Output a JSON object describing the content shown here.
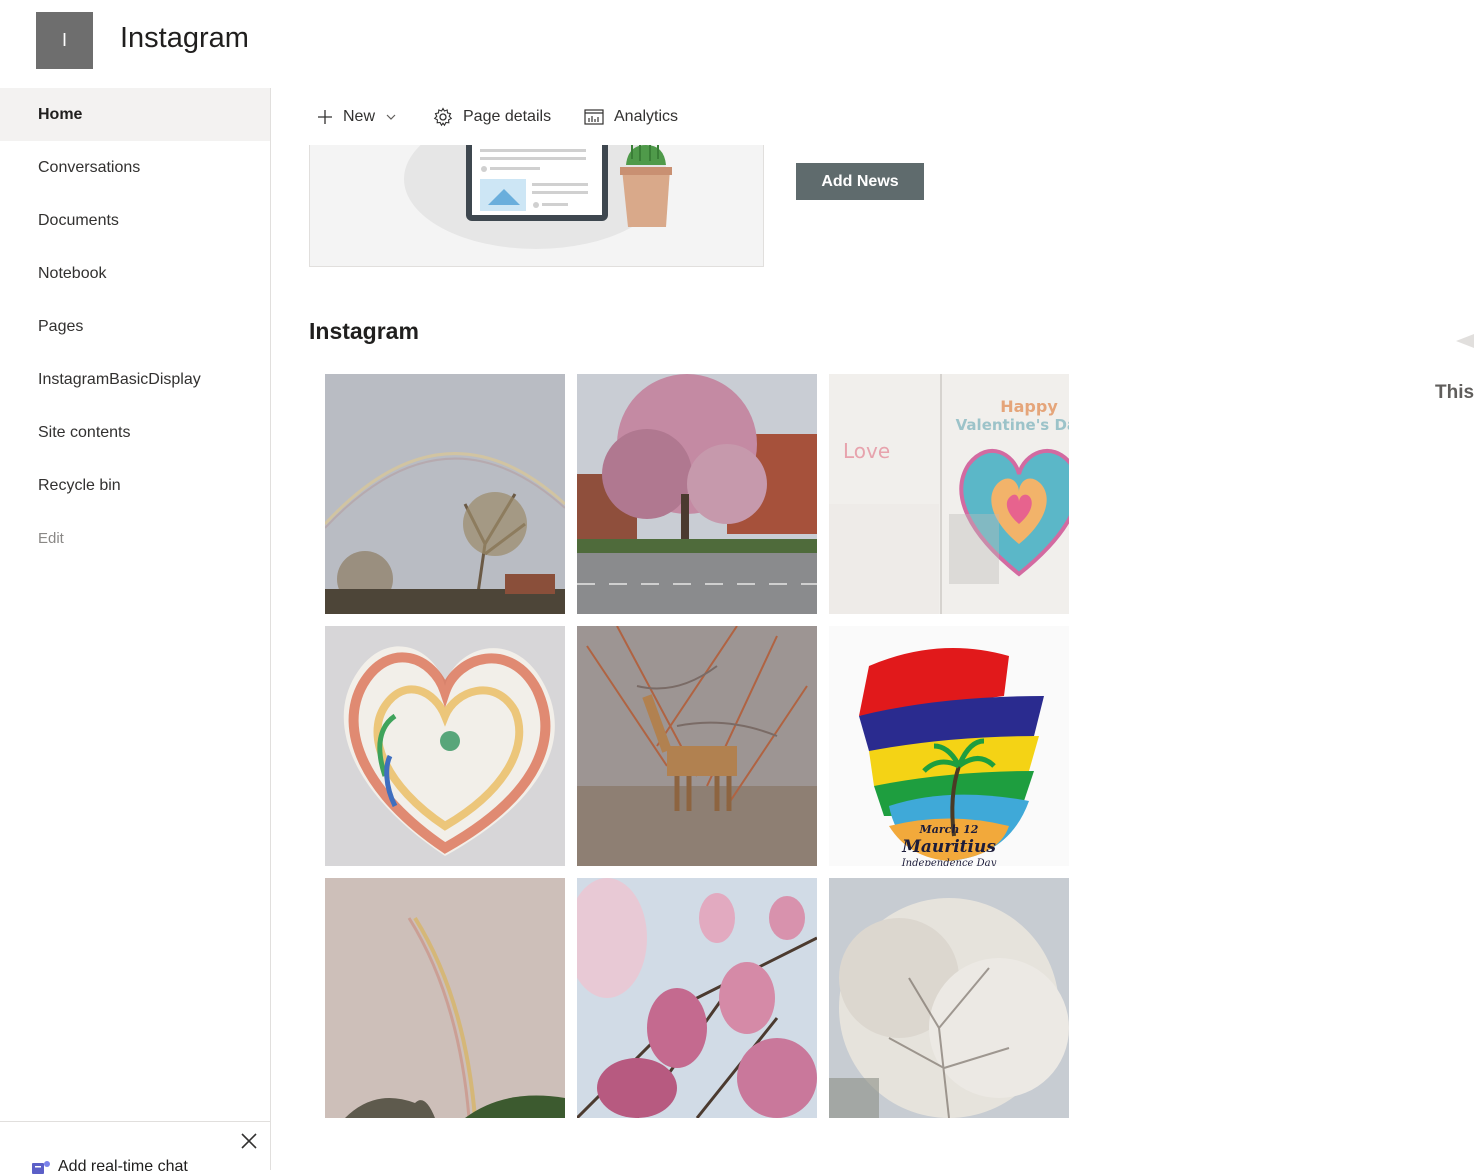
{
  "site": {
    "logo_letter": "I",
    "title": "Instagram"
  },
  "nav": {
    "items": [
      {
        "label": "Home",
        "active": true
      },
      {
        "label": "Conversations"
      },
      {
        "label": "Documents"
      },
      {
        "label": "Notebook"
      },
      {
        "label": "Pages"
      },
      {
        "label": "InstagramBasicDisplay"
      },
      {
        "label": "Site contents"
      },
      {
        "label": "Recycle bin"
      }
    ],
    "edit_label": "Edit"
  },
  "chat": {
    "label": "Add real-time chat"
  },
  "command_bar": {
    "new_label": "New",
    "page_details_label": "Page details",
    "analytics_label": "Analytics"
  },
  "news": {
    "add_news_label": "Add News"
  },
  "instagram_section": {
    "title": "Instagram",
    "photos": [
      {
        "subject": "rainbow over trees"
      },
      {
        "subject": "magnolia tree on street"
      },
      {
        "subject": "valentine card"
      },
      {
        "subject": "crayon heart drawing"
      },
      {
        "subject": "giraffe among trees"
      },
      {
        "subject": "mauritius independence day graphic"
      },
      {
        "subject": "rainbow in pink sky"
      },
      {
        "subject": "magnolia blossoms"
      },
      {
        "subject": "white blossom tree"
      }
    ],
    "mauritius_text": {
      "line1": "March 12",
      "line2": "Mauritius",
      "line3": "Independence Day"
    },
    "valentine_text": {
      "line1": "Happy",
      "line2": "Valentine's Day",
      "love": "Love"
    }
  },
  "offscreen_text": "This",
  "colors": {
    "accent_button": "#5f6b6d",
    "nav_active_bg": "#f3f2f1",
    "logo_bg": "#6e6e6e"
  }
}
